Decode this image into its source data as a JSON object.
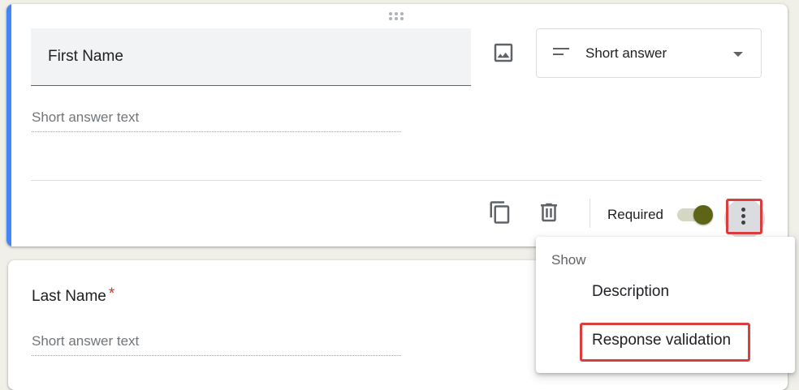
{
  "question1": {
    "title": "First Name",
    "type_label": "Short answer",
    "answer_placeholder": "Short answer text",
    "required_label": "Required",
    "required_on": true
  },
  "question2": {
    "title": "Last Name",
    "required_mark": "*",
    "answer_placeholder": "Short answer text"
  },
  "menu": {
    "header": "Show",
    "items": [
      "Description",
      "Response validation"
    ]
  },
  "colors": {
    "accent": "#4285f4",
    "toggle_on": "#5e6416",
    "highlight": "#db3c3c",
    "required_star": "#d93025"
  },
  "icons": [
    "drag-handle-icon",
    "image-icon",
    "short-answer-icon",
    "dropdown-caret-icon",
    "duplicate-icon",
    "delete-icon",
    "more-vert-icon"
  ]
}
